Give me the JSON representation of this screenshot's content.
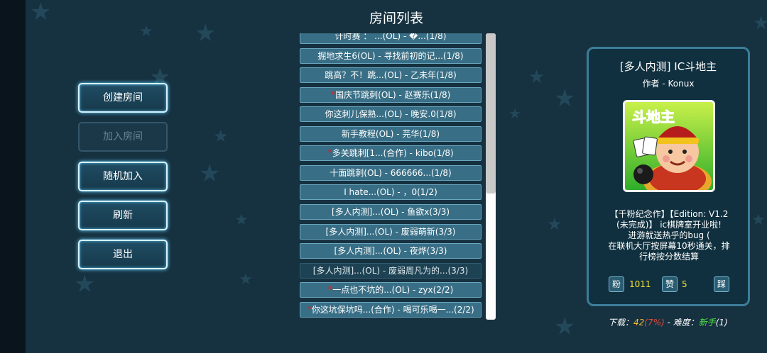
{
  "header": {
    "title": "房间列表"
  },
  "menu": {
    "create": "创建房间",
    "join": "加入房间",
    "random": "随机加入",
    "refresh": "刷新",
    "exit": "退出"
  },
  "rooms": [
    {
      "text": "计时赛 ： ...(OL) - �...(1/8)",
      "red_dot": false,
      "dark": false
    },
    {
      "text": "掘地求生6(OL) - 寻找前初的记...(1/8)",
      "red_dot": false,
      "dark": false
    },
    {
      "text": "跳高？不！跳...(OL) - 乙未年(1/8)",
      "red_dot": false,
      "dark": false
    },
    {
      "text": "国庆节跳刺(OL) - 赵赛乐(1/8)",
      "red_dot": true,
      "dark": false
    },
    {
      "text": "你这刺儿保熟...(OL) - 晚安.0(1/8)",
      "red_dot": false,
      "dark": false
    },
    {
      "text": "新手教程(OL) - 芫华(1/8)",
      "red_dot": false,
      "dark": false
    },
    {
      "text": "多关跳刺[1...(合作) - kibo(1/8)",
      "red_dot": true,
      "dark": false
    },
    {
      "text": "十面跳刺(OL) - 666666...(1/8)",
      "red_dot": false,
      "dark": false
    },
    {
      "text": "I hate...(OL) - ，0(1/2)",
      "red_dot": false,
      "dark": false
    },
    {
      "text": "[多人内测]...(OL) - 鱼欲x(3/3)",
      "red_dot": false,
      "dark": false
    },
    {
      "text": "[多人内测]...(OL) - 废弱萌新(3/3)",
      "red_dot": false,
      "dark": false
    },
    {
      "text": "[多人内测]...(OL) - 夜烨(3/3)",
      "red_dot": false,
      "dark": false
    },
    {
      "text": "[多人内测]...(OL) - 废弱周凡为的...(3/3)",
      "red_dot": false,
      "dark": true
    },
    {
      "text": "一点也不坑的...(OL) - zyx(2/2)",
      "red_dot": true,
      "dark": false
    },
    {
      "text": "你这坑保坑吗...(合作) - 喝可乐喝一...(2/2)",
      "red_dot": true,
      "dark": false
    }
  ],
  "scrollbar": {
    "position_fraction": 0.0,
    "visible_fraction": 0.56
  },
  "detail": {
    "title": "[多人内测] IC斗地主",
    "author": "作者 - Konux",
    "cover_text": "斗地主",
    "desc": [
      "【千粉纪念作】【Edition: V1.2",
      "(未完成)】        ic棋牌室开业啦!",
      "进游就送热乎的bug (",
      "在联机大厅按屏幕10秒通关，排",
      "行榜按分数结算"
    ],
    "fans_label": "粉",
    "fans": "1011",
    "likes_label": "赞",
    "likes": "5",
    "dislike_label": "踩"
  },
  "footer": {
    "download_label": "下载：",
    "download_count": "42",
    "download_pct": "(7%)",
    "difficulty_label": " - 难度：",
    "difficulty": "新手",
    "difficulty_num": "(1)"
  },
  "colors": {
    "background": "#163140",
    "accent": "#3c7d99",
    "highlight": "#f2e23a"
  }
}
